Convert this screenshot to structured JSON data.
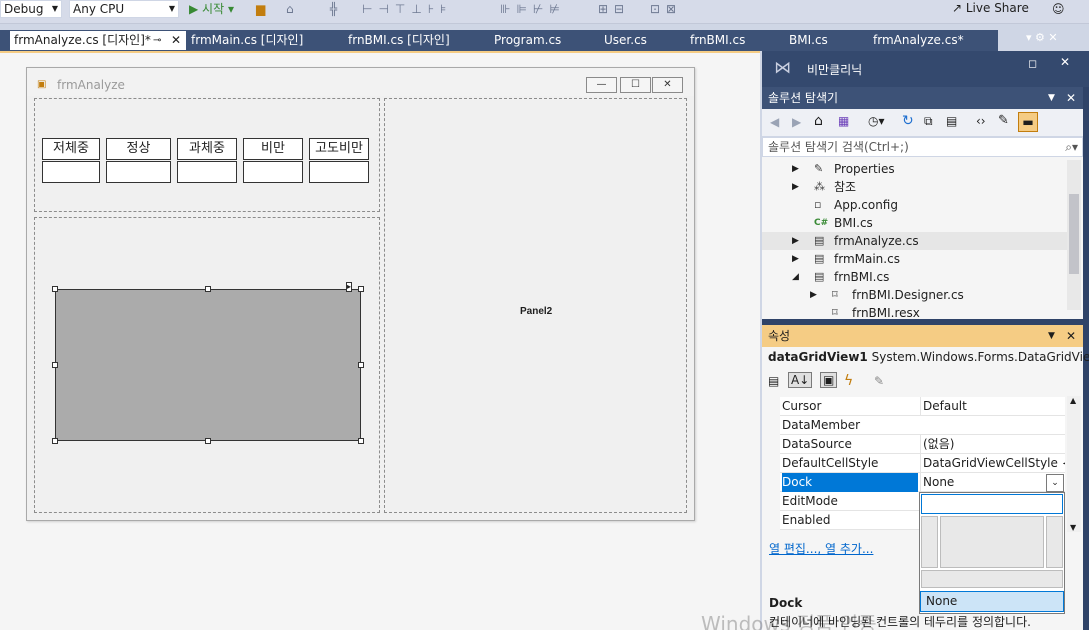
{
  "toolbar": {
    "config": "Debug",
    "platform": "Any CPU",
    "start": "▶ 시작 ▾",
    "live_share": "Live Share"
  },
  "tabs": [
    {
      "label": "frmAnalyze.cs [디자인]*"
    },
    {
      "label": "frmMain.cs [디자인]"
    },
    {
      "label": "frnBMI.cs [디자인]"
    },
    {
      "label": "Program.cs"
    },
    {
      "label": "User.cs"
    },
    {
      "label": "frnBMI.cs"
    },
    {
      "label": "BMI.cs"
    },
    {
      "label": "frmAnalyze.cs*"
    }
  ],
  "form": {
    "title": "frmAnalyze",
    "headers": [
      "저체중",
      "정상",
      "과체중",
      "비만",
      "고도비만"
    ],
    "panel2_label": "Panel2"
  },
  "top_right": {
    "title": "비만클리닉"
  },
  "solution_explorer": {
    "title": "솔루션 탐색기",
    "search_placeholder": "솔루션 탐색기 검색(Ctrl+;)",
    "items": [
      {
        "label": "Properties",
        "icon": "wrench-icon"
      },
      {
        "label": "참조",
        "icon": "references-icon"
      },
      {
        "label": "App.config",
        "icon": "config-file-icon"
      },
      {
        "label": "BMI.cs",
        "icon": "csharp-file-icon"
      },
      {
        "label": "frmAnalyze.cs",
        "icon": "form-file-icon"
      },
      {
        "label": "frmMain.cs",
        "icon": "form-file-icon"
      },
      {
        "label": "frnBMI.cs",
        "icon": "form-file-icon"
      },
      {
        "label": "frnBMI.Designer.cs",
        "icon": "designer-file-icon"
      },
      {
        "label": "frnBMI.resx",
        "icon": "resx-file-icon"
      }
    ]
  },
  "properties": {
    "title": "속성",
    "object_name": "dataGridView1",
    "object_type": "System.Windows.Forms.DataGridView",
    "rows": [
      {
        "name": "Cursor",
        "value": "Default"
      },
      {
        "name": "DataMember",
        "value": ""
      },
      {
        "name": "DataSource",
        "value": "(없음)"
      },
      {
        "name": "DefaultCellStyle",
        "value": "DataGridViewCellStyle { Ba"
      },
      {
        "name": "Dock",
        "value": "None"
      },
      {
        "name": "EditMode",
        "value": ""
      },
      {
        "name": "Enabled",
        "value": ""
      }
    ],
    "dock_popup_selected": "None",
    "link_edit_columns": "열 편집...",
    "link_add_column": "열 추가...",
    "desc_title": "Dock",
    "desc_text": "컨테이너에 바인딩된 컨트롤의 테두리를 정의합니다."
  },
  "watermark": "Windows 정품 인증"
}
